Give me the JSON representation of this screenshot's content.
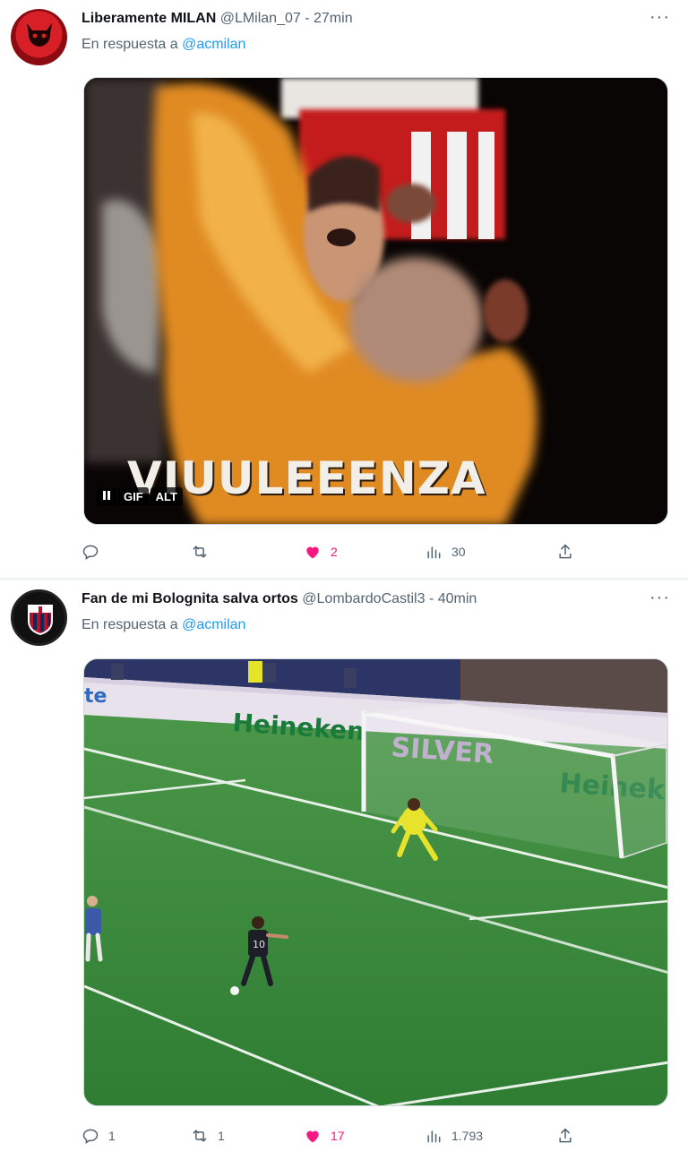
{
  "tweets": [
    {
      "name": "Liberamente MILAN",
      "handle": "@LMilan_07",
      "time": "- 27min",
      "more": "···",
      "reply_prefix": "En respuesta a",
      "reply_to": "@acmilan",
      "media": {
        "type": "gif",
        "caption": "VIUULEEENZA",
        "pause_icon": "pause-icon",
        "gif_label": "GIF",
        "alt_label": "ALT"
      },
      "stats": {
        "replies": "",
        "retweets": "",
        "likes": "2",
        "views": "30"
      }
    },
    {
      "name": "Fan de mi Bolognita salva ortos",
      "handle": "@LombardoCastil3",
      "time": "- 40min",
      "more": "···",
      "reply_prefix": "En respuesta a",
      "reply_to": "@acmilan",
      "media": {
        "type": "video-still",
        "board_1": "Heineken",
        "board_2": "SILVER",
        "board_3": "Heinek",
        "board_4": "te",
        "shirt_number": "10"
      },
      "stats": {
        "replies": "1",
        "retweets": "1",
        "likes": "17",
        "views": "1.793"
      }
    }
  ],
  "colors": {
    "like": "#f91880",
    "mention": "#1d9bf0",
    "muted": "#536471"
  },
  "icons": [
    "reply-icon",
    "retweet-icon",
    "heart-icon",
    "views-icon",
    "share-icon"
  ]
}
